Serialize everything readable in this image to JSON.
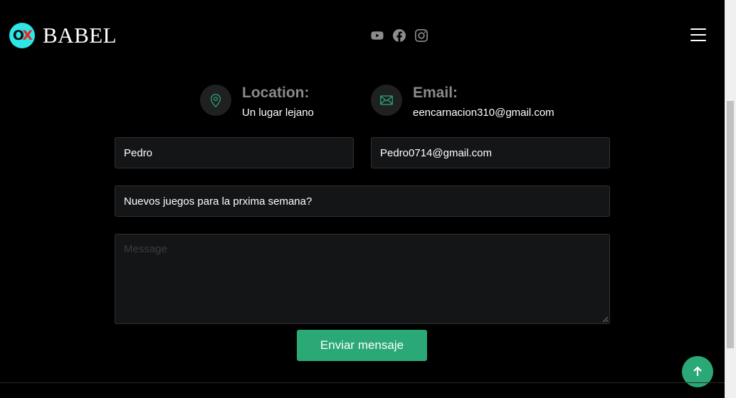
{
  "header": {
    "logo_badge_text": "OX",
    "logo_text": "BABEL",
    "socials": [
      "youtube-icon",
      "facebook-icon",
      "instagram-icon"
    ],
    "menu_icon": "hamburger-menu-icon"
  },
  "contact": {
    "location": {
      "title": "Location:",
      "value": "Un lugar lejano",
      "icon": "map-pin-icon"
    },
    "email": {
      "title": "Email:",
      "value": "eencarnacion310@gmail.com",
      "icon": "envelope-icon"
    }
  },
  "form": {
    "name_value": "Pedro",
    "email_value": "Pedro0714@gmail.com",
    "subject_value": "Nuevos juegos para la prxima semana?",
    "message_placeholder": "Message",
    "submit_label": "Enviar mensaje"
  },
  "colors": {
    "accent": "#2aa876",
    "background": "#000000",
    "field_bg": "#141517"
  },
  "scroll_top_icon": "arrow-up-icon"
}
